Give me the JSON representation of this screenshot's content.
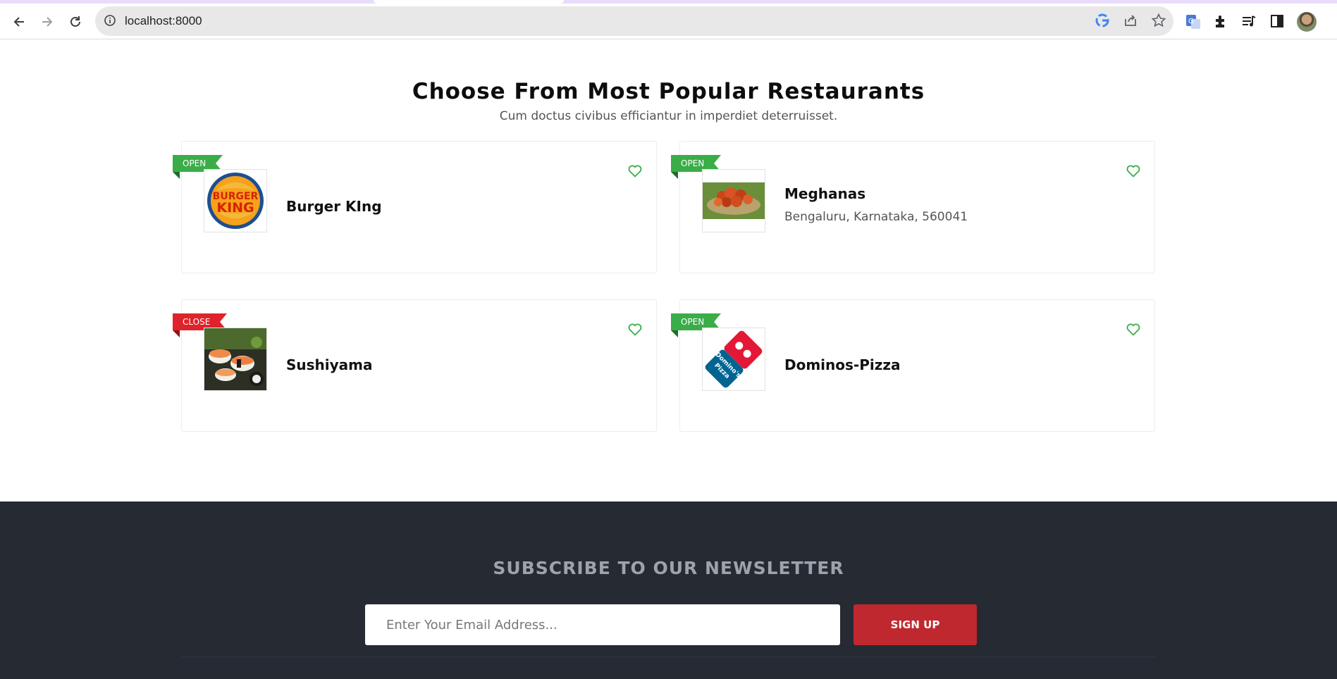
{
  "browser": {
    "url": "localhost:8000"
  },
  "section": {
    "title": "Choose From Most Popular Restaurants",
    "subtitle": "Cum doctus civibus efficiantur in imperdiet deterruisset."
  },
  "restaurants": [
    {
      "status": "OPEN",
      "name": "Burger KIng",
      "address": "",
      "logo": "burger-king-logo",
      "status_color": "#3aad49"
    },
    {
      "status": "OPEN",
      "name": "Meghanas",
      "address": "Bengaluru, Karnataka, 560041",
      "logo": "biryani-photo",
      "status_color": "#3aad49"
    },
    {
      "status": "CLOSE",
      "name": "Sushiyama",
      "address": "",
      "logo": "sushi-photo",
      "status_color": "#e0222b"
    },
    {
      "status": "OPEN",
      "name": "Dominos-Pizza",
      "address": "",
      "logo": "dominos-logo",
      "status_color": "#3aad49"
    }
  ],
  "logo_text": {
    "burger_king": [
      "BURGER",
      "KING"
    ],
    "dominos": [
      "Domino's",
      "Pizza"
    ]
  },
  "newsletter": {
    "title": "SUBSCRIBE TO OUR NEWSLETTER",
    "email_placeholder": "Enter Your Email Address...",
    "signup_label": "SIGN UP"
  },
  "colors": {
    "accent_green": "#3aad49",
    "accent_red": "#c0282f",
    "footer_bg": "#262a33"
  }
}
